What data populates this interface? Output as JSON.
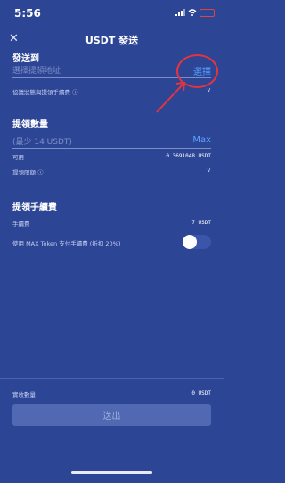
{
  "status": {
    "time": "5:56"
  },
  "header": {
    "close_icon": "close-icon",
    "title": "USDT 發送"
  },
  "send_to": {
    "heading": "發送到",
    "address_placeholder": "選擇提領地址",
    "select_link": "選擇",
    "protocol_label": "協議狀態與提領手續費 ⓘ"
  },
  "amount": {
    "heading": "提領數量",
    "placeholder": "(最少 14 USDT)",
    "max_link": "Max",
    "available_label": "可用",
    "available_value": "0.3691048 USDT",
    "limit_label": "提領限額 ⓘ"
  },
  "fee": {
    "heading": "提領手續費",
    "fee_label": "手續費",
    "fee_value": "7 USDT",
    "max_token_label": "使用 MAX Token 支付手續費 (折扣 20%)",
    "max_token_toggle_on": false
  },
  "footer": {
    "received_label": "實收數量",
    "received_value": "0 USDT",
    "submit_label": "送出"
  },
  "colors": {
    "background": "#2d4595",
    "accent": "#5aa0ff",
    "annotation": "#e5343f"
  }
}
